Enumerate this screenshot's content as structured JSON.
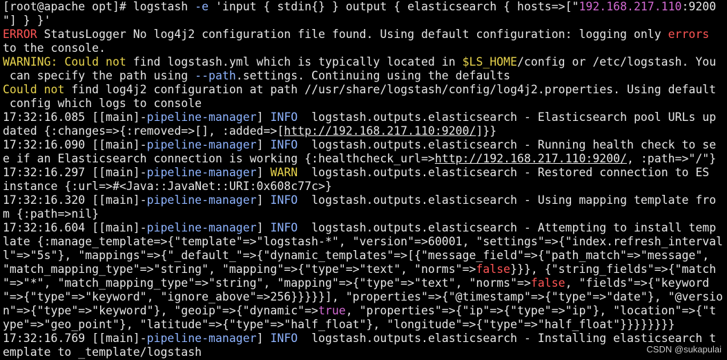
{
  "watermark": "CSDN @sukapulai",
  "colors": {
    "white": "#e6e6e6",
    "red": "#ff5555",
    "yellow": "#e8d44d",
    "magenta": "#d36ad3",
    "blue": "#8fb4ff"
  },
  "lines": [
    [
      {
        "t": "[root@apache opt]# logstash ",
        "c": "white"
      },
      {
        "t": "-e",
        "c": "blue"
      },
      {
        "t": " 'input { stdin{} } output { elasticsearch { hosts=>[\"",
        "c": "white"
      },
      {
        "t": "192.168.217.110",
        "c": "magenta"
      },
      {
        "t": ":9200",
        "c": "white"
      }
    ],
    [
      {
        "t": "\"] } }'",
        "c": "white"
      }
    ],
    [
      {
        "t": "ERROR",
        "c": "red"
      },
      {
        "t": " StatusLogger No log4j2 configuration file found. Using default configuration: logging only ",
        "c": "white"
      },
      {
        "t": "errors",
        "c": "red"
      }
    ],
    [
      {
        "t": "to the console.",
        "c": "white"
      }
    ],
    [
      {
        "t": "WARNING: Could not",
        "c": "yellow"
      },
      {
        "t": " find logstash.yml which is typically located in ",
        "c": "white"
      },
      {
        "t": "$LS_HOME",
        "c": "yellow"
      },
      {
        "t": "/config or /etc/logstash. You",
        "c": "white"
      }
    ],
    [
      {
        "t": " can specify the path using ",
        "c": "white"
      },
      {
        "t": "--path",
        "c": "blue"
      },
      {
        "t": ".settings. Continuing using the defaults",
        "c": "white"
      }
    ],
    [
      {
        "t": "Could not",
        "c": "yellow"
      },
      {
        "t": " find log4j2 configuration at path //usr/share/logstash/config/log4j2.properties. Using default",
        "c": "white"
      }
    ],
    [
      {
        "t": " config which logs to console",
        "c": "white"
      }
    ],
    [
      {
        "t": "17:32:16.085 [[main]-",
        "c": "white"
      },
      {
        "t": "pipeline-manager",
        "c": "blue"
      },
      {
        "t": "] ",
        "c": "white"
      },
      {
        "t": "INFO",
        "c": "blue"
      },
      {
        "t": "  logstash.outputs.elasticsearch - Elasticsearch pool URLs up",
        "c": "white"
      }
    ],
    [
      {
        "t": "dated {:changes=>{:removed=>[], :added=>[",
        "c": "white"
      },
      {
        "t": "http://192.168.217.110:9200/",
        "c": "link"
      },
      {
        "t": "]}}",
        "c": "white"
      }
    ],
    [
      {
        "t": "17:32:16.090 [[main]-",
        "c": "white"
      },
      {
        "t": "pipeline-manager",
        "c": "blue"
      },
      {
        "t": "] ",
        "c": "white"
      },
      {
        "t": "INFO",
        "c": "blue"
      },
      {
        "t": "  logstash.outputs.elasticsearch - Running health check to se",
        "c": "white"
      }
    ],
    [
      {
        "t": "e if an Elasticsearch connection is working {:healthcheck_url=>",
        "c": "white"
      },
      {
        "t": "http://192.168.217.110:9200/",
        "c": "link"
      },
      {
        "t": ", :path=>\"/\"}",
        "c": "white"
      }
    ],
    [
      {
        "t": "17:32:16.297 [[main]-",
        "c": "white"
      },
      {
        "t": "pipeline-manager",
        "c": "blue"
      },
      {
        "t": "] ",
        "c": "white"
      },
      {
        "t": "WARN",
        "c": "yellow"
      },
      {
        "t": "  logstash.outputs.elasticsearch - Restored connection to ES",
        "c": "white"
      }
    ],
    [
      {
        "t": "instance {:url=>#<Java::JavaNet::URI:0x608c77c>}",
        "c": "white"
      }
    ],
    [
      {
        "t": "17:32:16.320 [[main]-",
        "c": "white"
      },
      {
        "t": "pipeline-manager",
        "c": "blue"
      },
      {
        "t": "] ",
        "c": "white"
      },
      {
        "t": "INFO",
        "c": "blue"
      },
      {
        "t": "  logstash.outputs.elasticsearch - Using mapping template fro",
        "c": "white"
      }
    ],
    [
      {
        "t": "m {:path=>nil}",
        "c": "white"
      }
    ],
    [
      {
        "t": "17:32:16.604 [[main]-",
        "c": "white"
      },
      {
        "t": "pipeline-manager",
        "c": "blue"
      },
      {
        "t": "] ",
        "c": "white"
      },
      {
        "t": "INFO",
        "c": "blue"
      },
      {
        "t": "  logstash.outputs.elasticsearch - Attempting to install temp",
        "c": "white"
      }
    ],
    [
      {
        "t": "late {:manage_template=>{\"template\"=>\"logstash-*\", \"version\"=>60001, \"settings\"=>{\"index.refresh_interval",
        "c": "white"
      }
    ],
    [
      {
        "t": "l\"=>\"5s\"}, \"mappings\"=>{\"_default_\"=>{\"dynamic_templates\"=>[{\"message_field\"=>{\"path_match\"=>\"message\",",
        "c": "white"
      }
    ],
    [
      {
        "t": "\"match_mapping_type\"=>\"string\", \"mapping\"=>{\"type\"=>\"text\", \"norms\"=>",
        "c": "white"
      },
      {
        "t": "false",
        "c": "red"
      },
      {
        "t": "}}}, {\"string_fields\"=>{\"match",
        "c": "white"
      }
    ],
    [
      {
        "t": "\"=>\"*\", \"match_mapping_type\"=>\"string\", \"mapping\"=>{\"type\"=>\"text\", \"norms\"=>",
        "c": "white"
      },
      {
        "t": "false",
        "c": "red"
      },
      {
        "t": ", \"fields\"=>{\"keyword",
        "c": "white"
      }
    ],
    [
      {
        "t": "\"=>{\"type\"=>\"keyword\", \"ignore_above\"=>256}}}}}], \"properties\"=>{\"@timestamp\"=>{\"type\"=>\"date\"}, \"@versio",
        "c": "white"
      }
    ],
    [
      {
        "t": "n\"=>{\"type\"=>\"keyword\"}, \"geoip\"=>{\"dynamic\"=>",
        "c": "white"
      },
      {
        "t": "true",
        "c": "magenta"
      },
      {
        "t": ", \"properties\"=>{\"ip\"=>{\"type\"=>\"ip\"}, \"location\"=>{\"t",
        "c": "white"
      }
    ],
    [
      {
        "t": "ype\"=>\"geo_point\"}, \"latitude\"=>{\"type\"=>\"half_float\"}, \"longitude\"=>{\"type\"=>\"half_float\"}}}}}}}}",
        "c": "white"
      }
    ],
    [
      {
        "t": "17:32:16.769 [[main]-",
        "c": "white"
      },
      {
        "t": "pipeline-manager",
        "c": "blue"
      },
      {
        "t": "] ",
        "c": "white"
      },
      {
        "t": "INFO",
        "c": "blue"
      },
      {
        "t": "  logstash.outputs.elasticsearch - Installing elasticsearch t",
        "c": "white"
      }
    ],
    [
      {
        "t": "emplate to _template/logstash",
        "c": "white"
      }
    ]
  ]
}
